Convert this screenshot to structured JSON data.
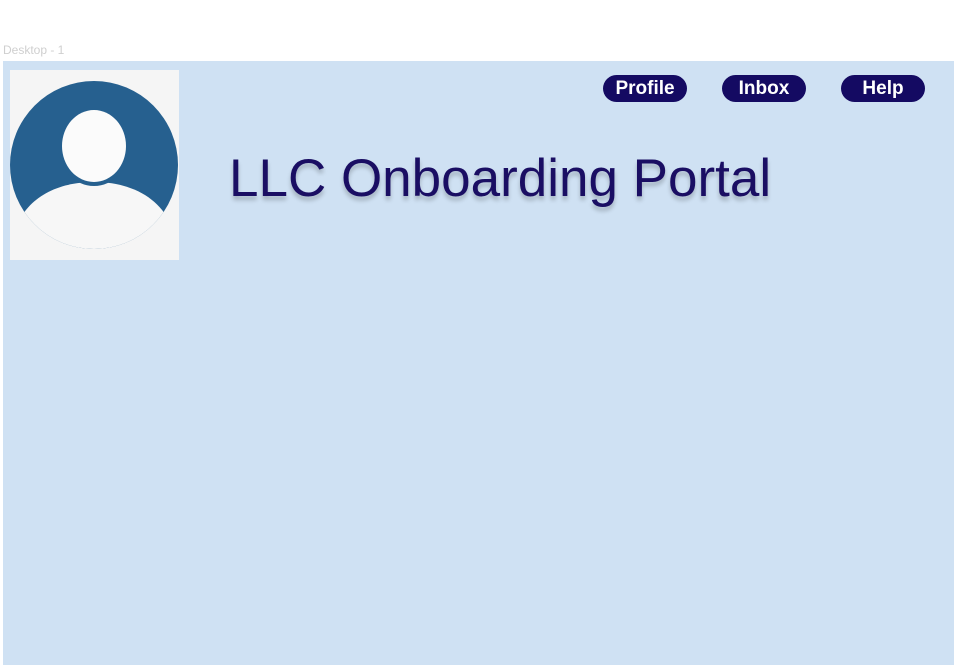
{
  "frame": {
    "label": "Desktop - 1",
    "background": "#cfe1f3"
  },
  "header": {
    "avatar_icon": "user-avatar-placeholder-icon",
    "title": "LLC Onboarding Portal",
    "title_color": "#1a0e63"
  },
  "nav": {
    "items": [
      {
        "label": "Profile"
      },
      {
        "label": "Inbox"
      },
      {
        "label": "Help"
      }
    ],
    "button_color": "#140a62",
    "text_color": "#ffffff"
  }
}
